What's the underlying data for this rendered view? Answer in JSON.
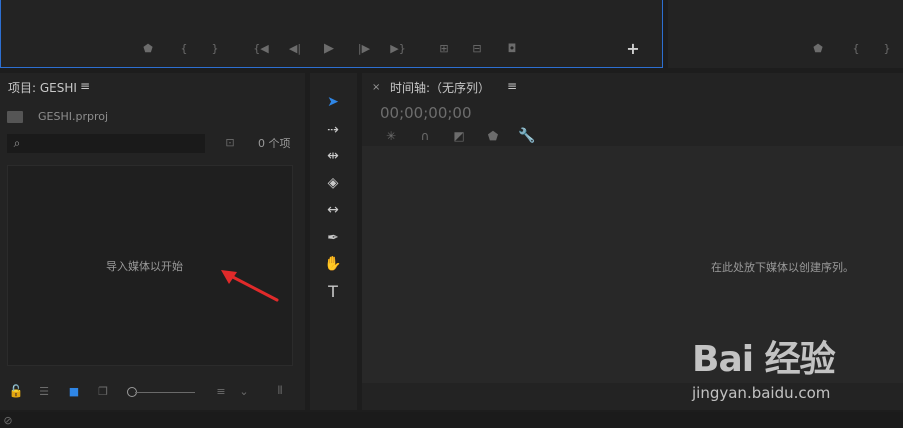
{
  "source_monitor": {
    "controls": [
      "marker-icon",
      "mark-in-icon",
      "mark-out-icon",
      "go-to-in-icon",
      "step-back-icon",
      "play-icon",
      "step-forward-icon",
      "go-to-out-icon",
      "insert-icon",
      "overwrite-icon",
      "export-frame-icon",
      "add-button-icon"
    ],
    "add_label": "+"
  },
  "program_monitor": {
    "controls": [
      "marker-icon",
      "mark-in-icon",
      "mark-out-icon"
    ]
  },
  "project": {
    "title": "项目: GESHI",
    "menu": "≡",
    "file_name": "GESHI.prproj",
    "search": {
      "value": "",
      "placeholder": ""
    },
    "item_count": "0 个项",
    "empty_text": "导入媒体以开始"
  },
  "tools": [
    "selection-tool-icon",
    "track-select-tool-icon",
    "ripple-edit-tool-icon",
    "razor-tool-icon",
    "slip-tool-icon",
    "pen-tool-icon",
    "hand-tool-icon",
    "type-tool-icon"
  ],
  "timeline": {
    "close": "×",
    "title": "时间轴:（无序列）",
    "menu": "≡",
    "timecode": "00;00;00;00",
    "empty_text": "在此处放下媒体以创建序列。"
  },
  "watermark": {
    "brand": "Bai  经验",
    "url": "jingyan.baidu.com"
  },
  "colors": {
    "accent": "#2f86e6",
    "arrow": "#e02a2a",
    "panel": "#232323",
    "background": "#1d1d1d"
  }
}
